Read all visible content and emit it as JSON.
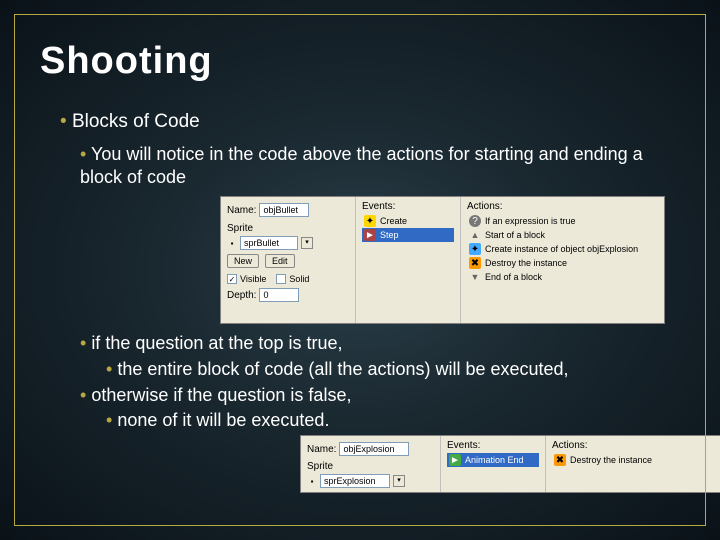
{
  "title": "Shooting",
  "b1": "Blocks of Code",
  "b2a": "You will notice in the code above the actions for starting and ending a block of code",
  "b2b": "if the question at the top is true,",
  "b3b": "the entire block of code (all the actions) will be executed,",
  "b2c": "otherwise if the question is false,",
  "b3c": "none of it will be executed.",
  "panel1": {
    "labels": {
      "name": "Name:",
      "sprite": "Sprite",
      "visible": "Visible",
      "solid": "Solid",
      "depth": "Depth:",
      "events": "Events:",
      "actions": "Actions:"
    },
    "nameVal": "objBullet",
    "spriteVal": "sprBullet",
    "buttons": {
      "new": "New",
      "edit": "Edit"
    },
    "visibleChecked": "✓",
    "depthVal": "0",
    "events": [
      {
        "icon": "bulb",
        "label": "Create",
        "sel": false
      },
      {
        "icon": "step",
        "label": "Step",
        "sel": true
      }
    ],
    "actions": [
      {
        "icon": "q",
        "label": "If an expression is true"
      },
      {
        "icon": "tri",
        "label": "Start of a block"
      },
      {
        "icon": "blue",
        "label": "Create instance of object objExplosion"
      },
      {
        "icon": "orange",
        "label": "Destroy the instance"
      },
      {
        "icon": "tri",
        "label": "End of a block"
      }
    ]
  },
  "panel2": {
    "labels": {
      "name": "Name:",
      "sprite": "Sprite",
      "events": "Events:",
      "actions": "Actions:"
    },
    "nameVal": "objExplosion",
    "spriteVal": "sprExplosion",
    "events": [
      {
        "icon": "green",
        "label": "Animation End",
        "sel": true
      }
    ],
    "actions": [
      {
        "icon": "orange",
        "label": "Destroy the instance"
      }
    ]
  }
}
